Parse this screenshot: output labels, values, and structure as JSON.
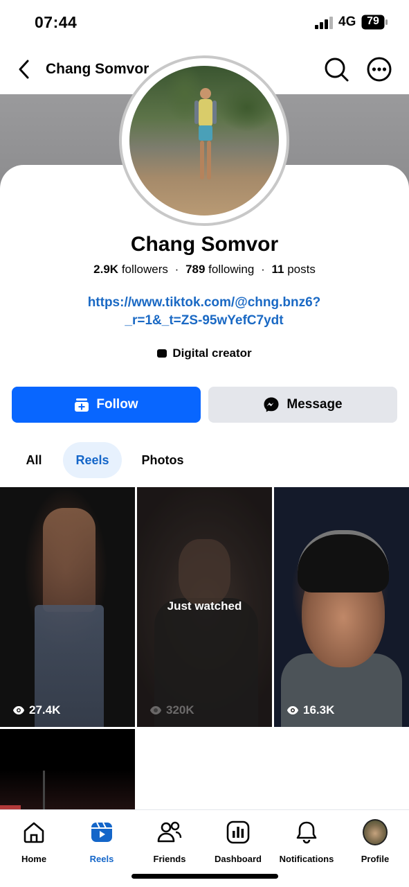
{
  "status_bar": {
    "time": "07:44",
    "network": "4G",
    "battery": "79"
  },
  "nav": {
    "title": "Chang Somvor"
  },
  "profile": {
    "name": "Chang Somvor",
    "followers_count": "2.9K",
    "followers_label": "followers",
    "following_count": "789",
    "following_label": "following",
    "posts_count": "11",
    "posts_label": "posts",
    "separator": "·",
    "link_line1": "https://www.tiktok.com/@chng.bnz6?",
    "link_line2": "_r=1&_t=ZS-95wYefC7ydt",
    "category": "Digital creator"
  },
  "actions": {
    "follow_label": "Follow",
    "message_label": "Message",
    "follow_color": "#0866ff"
  },
  "content_tabs": [
    {
      "label": "All"
    },
    {
      "label": "Reels",
      "active": true
    },
    {
      "label": "Photos"
    }
  ],
  "reels": [
    {
      "views": "27.4K"
    },
    {
      "views": "320K",
      "overlay": "Just watched"
    },
    {
      "views": "16.3K"
    }
  ],
  "bottom_tabs": [
    {
      "label": "Home",
      "icon": "home-icon"
    },
    {
      "label": "Reels",
      "icon": "reels-icon",
      "active": true
    },
    {
      "label": "Friends",
      "icon": "friends-icon"
    },
    {
      "label": "Dashboard",
      "icon": "dashboard-icon"
    },
    {
      "label": "Notifications",
      "icon": "bell-icon"
    },
    {
      "label": "Profile",
      "icon": "profile-avatar"
    }
  ],
  "accent_color": "#1466c9"
}
